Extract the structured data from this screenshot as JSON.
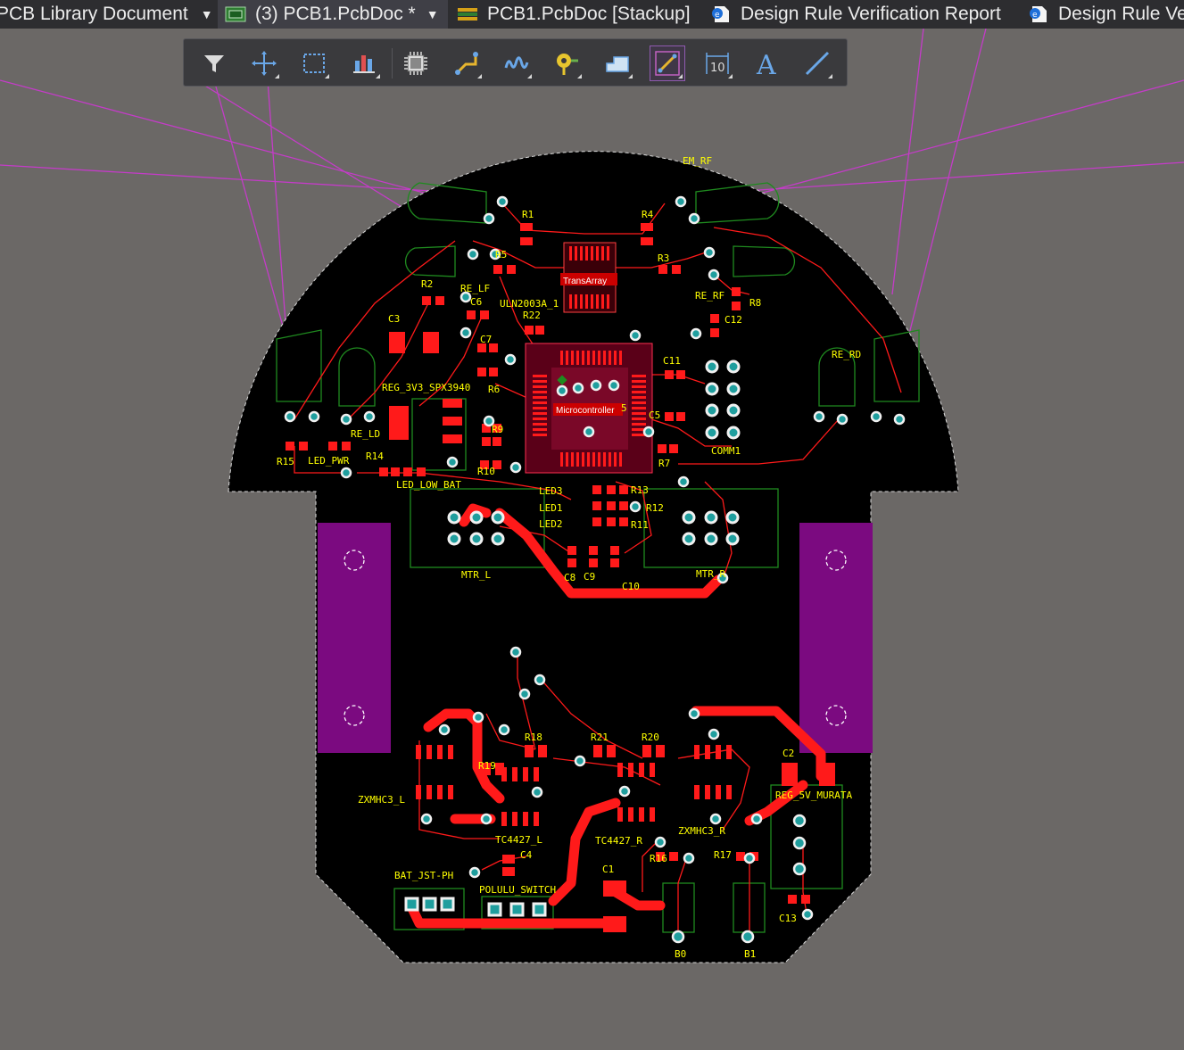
{
  "tabs": [
    {
      "label": "PCB Library Document",
      "icon": "pcblib-doc-icon",
      "active": false,
      "dropdown": true
    },
    {
      "label": "(3) PCB1.PcbDoc *",
      "icon": "pcb-doc-icon",
      "active": true,
      "dropdown": true
    },
    {
      "label": "PCB1.PcbDoc [Stackup]",
      "icon": "stackup-icon",
      "active": false,
      "dropdown": false
    },
    {
      "label": "Design Rule Verification Report",
      "icon": "report-doc-icon",
      "active": false,
      "dropdown": false
    },
    {
      "label": "Design Rule Ve",
      "icon": "report-doc-icon",
      "active": false,
      "dropdown": false
    }
  ],
  "toolbar": {
    "tools": [
      {
        "name": "filter-tool",
        "icon": "filter-icon"
      },
      {
        "name": "move-tool",
        "icon": "move-cross-icon"
      },
      {
        "name": "select-tool",
        "icon": "select-rect-icon"
      },
      {
        "name": "align-tool",
        "icon": "align-bars-icon"
      },
      {
        "name": "place-component-tool",
        "icon": "component-icon"
      },
      {
        "name": "interactive-routing-tool",
        "icon": "route-icon"
      },
      {
        "name": "length-tuning-tool",
        "icon": "tune-icon"
      },
      {
        "name": "place-via-tool",
        "icon": "via-icon"
      },
      {
        "name": "place-polygon-tool",
        "icon": "polygon-icon"
      },
      {
        "name": "place-track-tool",
        "icon": "track-icon",
        "selected": true
      },
      {
        "name": "place-dimension-tool",
        "icon": "dimension-icon"
      },
      {
        "name": "place-string-tool",
        "icon": "text-icon"
      },
      {
        "name": "place-line-tool",
        "icon": "line-icon"
      }
    ],
    "dimension_value": "10",
    "text_glyph": "A"
  },
  "colors": {
    "background": "#6b6866",
    "board": "#000000",
    "copper_top": "#ff0000",
    "silkscreen": "#ffff00",
    "overlay_green": "#1f8a1f",
    "keepout_magenta": "#c43cc8",
    "mechanical_purple": "#7b0a80",
    "pad_teal": "#1f9e9e"
  },
  "components": {
    "em_rf": "EM_RF",
    "r1": "R1",
    "r4": "R4",
    "r5": "R5",
    "r3": "R3",
    "r2": "R2",
    "re_lf": "RE_LF",
    "transarray": "TransArray",
    "c6": "C6",
    "re_rf": "RE_RF",
    "r8": "R8",
    "uln": "ULN2003A_1",
    "r22": "R22",
    "c12": "C12",
    "c3": "C3",
    "c7": "C7",
    "c11": "C11",
    "re_rd": "RE_RD",
    "reg33": "REG_3V3_SPX3940",
    "r6": "R6",
    "mcu": "Microcontroller",
    "c5": "C5",
    "re_ld": "RE_LD",
    "r9": "R9",
    "comm1": "COMM1",
    "r15": "R15",
    "led_pwr": "LED_PWR",
    "r14": "R14",
    "r10": "R10",
    "r7": "R7",
    "led_low_bat": "LED_LOW_BAT",
    "led3": "LED3",
    "led1": "LED1",
    "led2": "LED2",
    "r13": "R13",
    "r12": "R12",
    "r11": "R11",
    "mtr_l": "MTR_L",
    "mtr_r": "MTR_R",
    "c8": "C8",
    "c9": "C9",
    "c10": "C10",
    "r18": "R18",
    "r21": "R21",
    "r20": "R20",
    "r19": "R19",
    "c2": "C2",
    "zx_l": "ZXMHC3_L",
    "reg5": "REG_5V_MURATA",
    "tc_l": "TC4427_L",
    "tc_r": "TC4427_R",
    "zx_r": "ZXMHC3_R",
    "r16": "R16",
    "r17": "R17",
    "c4": "C4",
    "c1": "C1",
    "bat": "BAT_JST-PH",
    "pol": "POLULU_SWITCH",
    "c13": "C13",
    "b0": "B0",
    "b1": "B1",
    "mcu_pin": "5"
  }
}
